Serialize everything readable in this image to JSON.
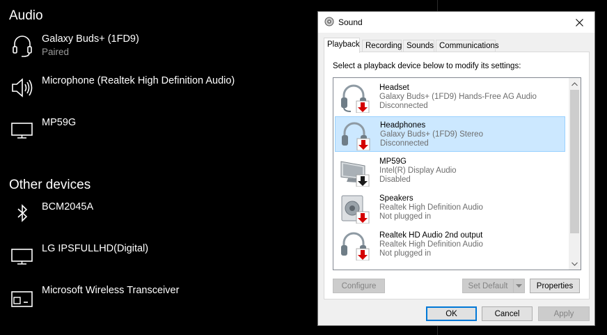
{
  "settings": {
    "audio_title": "Audio",
    "audio_devices": [
      {
        "name": "Galaxy Buds+ (1FD9)",
        "status": "Paired",
        "icon": "headset-icon"
      },
      {
        "name": "Microphone (Realtek High Definition Audio)",
        "status": "",
        "icon": "speaker-icon"
      },
      {
        "name": "MP59G",
        "status": "",
        "icon": "monitor-icon"
      }
    ],
    "other_title": "Other devices",
    "other_devices": [
      {
        "name": "BCM2045A",
        "icon": "bluetooth-icon"
      },
      {
        "name": "LG IPSFULLHD(Digital)",
        "icon": "monitor-icon"
      },
      {
        "name": "Microsoft Wireless Transceiver",
        "icon": "transceiver-icon"
      }
    ]
  },
  "dialog": {
    "title": "Sound",
    "tabs": [
      "Playback",
      "Recording",
      "Sounds",
      "Communications"
    ],
    "active_tab": "Playback",
    "instruction": "Select a playback device below to modify its settings:",
    "devices": [
      {
        "name": "Headset",
        "desc": "Galaxy Buds+ (1FD9) Hands-Free AG Audio",
        "status": "Disconnected",
        "icon": "headset-device-icon",
        "badge": "red-down-arrow",
        "selected": false
      },
      {
        "name": "Headphones",
        "desc": "Galaxy Buds+ (1FD9) Stereo",
        "status": "Disconnected",
        "icon": "headphones-device-icon",
        "badge": "red-down-arrow",
        "selected": true
      },
      {
        "name": "MP59G",
        "desc": "Intel(R) Display Audio",
        "status": "Disabled",
        "icon": "monitor-device-icon",
        "badge": "black-down-arrow",
        "selected": false
      },
      {
        "name": "Speakers",
        "desc": "Realtek High Definition Audio",
        "status": "Not plugged in",
        "icon": "speakers-device-icon",
        "badge": "red-down-arrow",
        "selected": false
      },
      {
        "name": "Realtek HD Audio 2nd output",
        "desc": "Realtek High Definition Audio",
        "status": "Not plugged in",
        "icon": "headphones-device-icon",
        "badge": "red-down-arrow",
        "selected": false
      }
    ],
    "buttons": {
      "configure": "Configure",
      "set_default": "Set Default",
      "properties": "Properties",
      "ok": "OK",
      "cancel": "Cancel",
      "apply": "Apply"
    }
  },
  "colors": {
    "selection_bg": "#cce8ff",
    "selection_border": "#99d1ff",
    "default_button_border": "#0078d7",
    "badge_red": "#d40000"
  }
}
